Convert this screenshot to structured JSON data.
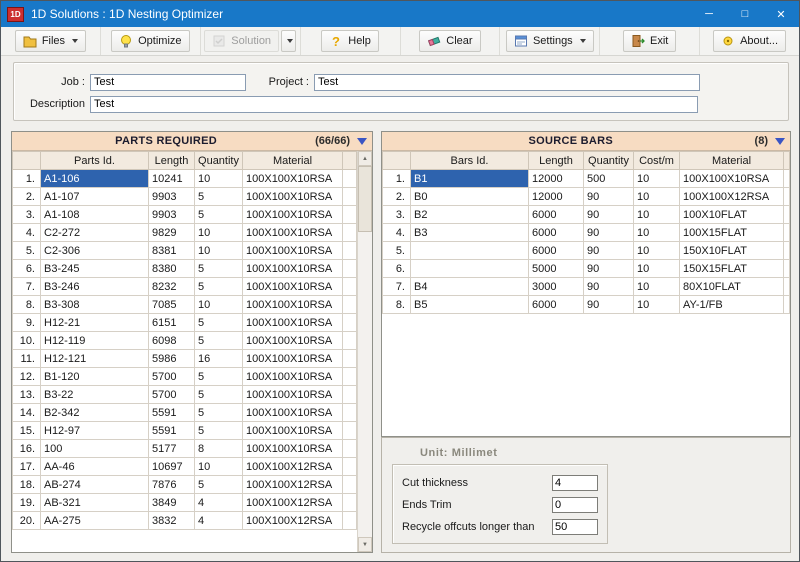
{
  "window": {
    "title": "1D Solutions :  1D Nesting Optimizer",
    "logo_text": "1D",
    "controls": {
      "minimize": "─",
      "maximize": "□",
      "close": "✕"
    }
  },
  "toolbar": {
    "files_label": "Files",
    "optimize_label": "Optimize",
    "solution_label": "Solution",
    "help_label": "Help",
    "clear_label": "Clear",
    "settings_label": "Settings",
    "exit_label": "Exit",
    "about_label": "About..."
  },
  "job_form": {
    "job_label": "Job :",
    "job_value": "Test",
    "project_label": "Project :",
    "project_value": "Test",
    "description_label": "Description",
    "description_value": "Test"
  },
  "parts_panel": {
    "title": "PARTS REQUIRED",
    "count": "(66/66)",
    "columns": [
      "Parts Id.",
      "Length",
      "Quantity",
      "Material"
    ],
    "rows": [
      {
        "num": "1.",
        "id": "A1-106",
        "length": "10241",
        "qty": "10",
        "material": "100X100X10RSA",
        "selected": true
      },
      {
        "num": "2.",
        "id": "A1-107",
        "length": "9903",
        "qty": "5",
        "material": "100X100X10RSA"
      },
      {
        "num": "3.",
        "id": "A1-108",
        "length": "9903",
        "qty": "5",
        "material": "100X100X10RSA"
      },
      {
        "num": "4.",
        "id": "C2-272",
        "length": "9829",
        "qty": "10",
        "material": "100X100X10RSA"
      },
      {
        "num": "5.",
        "id": "C2-306",
        "length": "8381",
        "qty": "10",
        "material": "100X100X10RSA"
      },
      {
        "num": "6.",
        "id": "B3-245",
        "length": "8380",
        "qty": "5",
        "material": "100X100X10RSA"
      },
      {
        "num": "7.",
        "id": "B3-246",
        "length": "8232",
        "qty": "5",
        "material": "100X100X10RSA"
      },
      {
        "num": "8.",
        "id": "B3-308",
        "length": "7085",
        "qty": "10",
        "material": "100X100X10RSA"
      },
      {
        "num": "9.",
        "id": "H12-21",
        "length": "6151",
        "qty": "5",
        "material": "100X100X10RSA"
      },
      {
        "num": "10.",
        "id": "H12-119",
        "length": "6098",
        "qty": "5",
        "material": "100X100X10RSA"
      },
      {
        "num": "11.",
        "id": "H12-121",
        "length": "5986",
        "qty": "16",
        "material": "100X100X10RSA"
      },
      {
        "num": "12.",
        "id": "B1-120",
        "length": "5700",
        "qty": "5",
        "material": "100X100X10RSA"
      },
      {
        "num": "13.",
        "id": "B3-22",
        "length": "5700",
        "qty": "5",
        "material": "100X100X10RSA"
      },
      {
        "num": "14.",
        "id": "B2-342",
        "length": "5591",
        "qty": "5",
        "material": "100X100X10RSA"
      },
      {
        "num": "15.",
        "id": "H12-97",
        "length": "5591",
        "qty": "5",
        "material": "100X100X10RSA"
      },
      {
        "num": "16.",
        "id": "100",
        "length": "5177",
        "qty": "8",
        "material": "100X100X10RSA"
      },
      {
        "num": "17.",
        "id": "AA-46",
        "length": "10697",
        "qty": "10",
        "material": "100X100X12RSA"
      },
      {
        "num": "18.",
        "id": "AB-274",
        "length": "7876",
        "qty": "5",
        "material": "100X100X12RSA"
      },
      {
        "num": "19.",
        "id": "AB-321",
        "length": "3849",
        "qty": "4",
        "material": "100X100X12RSA"
      },
      {
        "num": "20.",
        "id": "AA-275",
        "length": "3832",
        "qty": "4",
        "material": "100X100X12RSA"
      }
    ]
  },
  "source_panel": {
    "title": "SOURCE BARS",
    "count": "(8)",
    "columns": [
      "Bars Id.",
      "Length",
      "Quantity",
      "Cost/m",
      "Material"
    ],
    "rows": [
      {
        "num": "1.",
        "id": "B1",
        "length": "12000",
        "qty": "500",
        "cost": "10",
        "material": "100X100X10RSA",
        "selected": true
      },
      {
        "num": "2.",
        "id": "B0",
        "length": "12000",
        "qty": "90",
        "cost": "10",
        "material": "100X100X12RSA"
      },
      {
        "num": "3.",
        "id": "B2",
        "length": "6000",
        "qty": "90",
        "cost": "10",
        "material": "100X10FLAT"
      },
      {
        "num": "4.",
        "id": "B3",
        "length": "6000",
        "qty": "90",
        "cost": "10",
        "material": "100X15FLAT"
      },
      {
        "num": "5.",
        "id": "",
        "length": "6000",
        "qty": "90",
        "cost": "10",
        "material": "150X10FLAT"
      },
      {
        "num": "6.",
        "id": "",
        "length": "5000",
        "qty": "90",
        "cost": "10",
        "material": "150X15FLAT"
      },
      {
        "num": "7.",
        "id": "B4",
        "length": "3000",
        "qty": "90",
        "cost": "10",
        "material": "80X10FLAT"
      },
      {
        "num": "8.",
        "id": "B5",
        "length": "6000",
        "qty": "90",
        "cost": "10",
        "material": "AY-1/FB"
      }
    ]
  },
  "unit_area": {
    "title": "Unit: Millimet",
    "fields": [
      {
        "label": "Cut thickness",
        "value": "4"
      },
      {
        "label": "Ends Trim",
        "value": "0"
      },
      {
        "label": "Recycle offcuts longer than",
        "value": "50"
      }
    ]
  },
  "colors": {
    "titlebar": "#1878c8",
    "panel_header": "#f7dcc2",
    "selection": "#2e63ae"
  }
}
